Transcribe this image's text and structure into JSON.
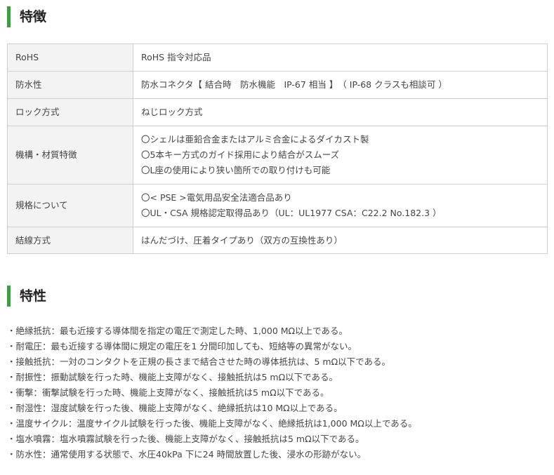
{
  "features": {
    "heading": "特徴",
    "rows": [
      {
        "label": "RoHS",
        "lines": [
          "RoHS 指令対応品"
        ]
      },
      {
        "label": "防水性",
        "lines": [
          "防水コネクタ【 結合時　防水機能　IP-67 相当 】　（ IP-68 クラスも相談可 ）"
        ]
      },
      {
        "label": "ロック方式",
        "lines": [
          "ねじロック方式"
        ]
      },
      {
        "label": "機構・材質特徴",
        "lines": [
          "〇シェルは亜鉛合金またはアルミ合金によるダイカスト製",
          "〇5本キー方式のガイド採用により結合がスムーズ",
          "〇L座の使用により狭い箇所での取り付けも可能"
        ]
      },
      {
        "label": "規格について",
        "lines": [
          "〇< PSE >電気用品安全法適合品あり",
          "〇UL・CSA 規格認定取得品あり（UL：UL1977 CSA：C22.2 No.182.3 ）"
        ]
      },
      {
        "label": "結線方式",
        "lines": [
          "はんだづけ、圧着タイプあり（双方の互換性あり）"
        ]
      }
    ]
  },
  "characteristics": {
    "heading": "特性",
    "items": [
      "・絶縁抵抗：最も近接する導体間を指定の電圧で測定した時、1,000 MΩ以上である。",
      "・耐電圧：最も近接する導体間に規定の電圧を1 分間印加しても、短絡等の異常がない。",
      "・接触抵抗：一対のコンタクトを正規の長さまで結合させた時の導体抵抗は、5 mΩ以下である。",
      "・耐振性：振動試験を行った時、機能上支障がなく、接触抵抗は5 mΩ以下である。",
      "・衝撃：衝撃試験を行った時、機能上支障がなく、接触抵抗は5 mΩ以下である。",
      "・耐湿性：湿度試験を行った後、機能上支障がなく、絶縁抵抗は10 MΩ以上である。",
      "・温度サイクル：温度サイクル試験を行った後、機能上支障がなく、絶縁抵抗は1,000 MΩ以上である。",
      "・塩水噴霧：塩水噴霧試験を行った後、機能上支障がなく、接触抵抗は5 mΩ以下である。",
      "・防水性：通常使用する状態で、水圧40kPa 下に24 時間放置した後、浸水の形跡がない。"
    ]
  },
  "colors": {
    "heading_accent": "#3f9b45",
    "label_cell_bg": "#f3f3f3",
    "border": "#cfcfcf"
  }
}
